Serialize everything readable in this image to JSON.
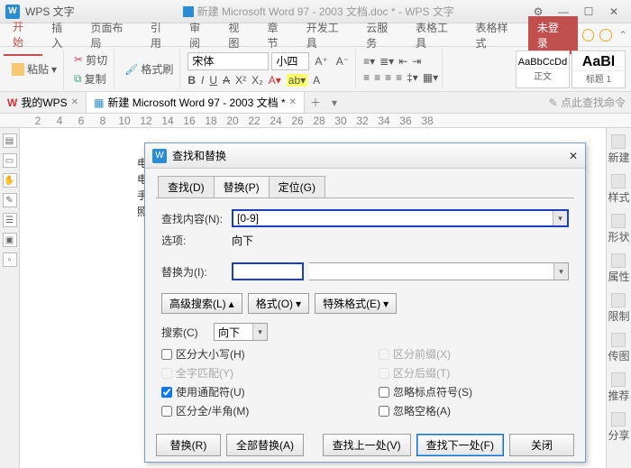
{
  "title_bar": {
    "app_name": "WPS 文字",
    "doc_name": "新建 Microsoft Word 97 - 2003 文档.doc * - WPS 文字"
  },
  "ribbon": {
    "tabs": [
      "开始",
      "插入",
      "页面布局",
      "引用",
      "审阅",
      "视图",
      "章节",
      "开发工具",
      "云服务",
      "表格工具",
      "表格样式"
    ],
    "login": "未登录"
  },
  "toolbar": {
    "cut": "剪切",
    "copy": "复制",
    "paste": "粘贴",
    "brush": "格式刷",
    "font_name": "宋体",
    "font_size": "小四",
    "style1_prev": "AaBbCcDd",
    "style1_lbl": "正文",
    "style2_prev": "AaBl",
    "style2_lbl": "标题 1"
  },
  "doc_tabs": {
    "home": "我的WPS",
    "doc": "新建 Microsoft Word 97 - 2003 文档 *",
    "cmd": "点此查找命令"
  },
  "doc_text": {
    "l1": "电行",
    "l2": "电讠",
    "l3": "手朾",
    "l4": "照丿"
  },
  "right_panel": [
    "新建",
    "样式",
    "形状",
    "属性",
    "限制",
    "传图",
    "推荐",
    "分享"
  ],
  "ruler": [
    "2",
    "4",
    "6",
    "8",
    "10",
    "12",
    "14",
    "16",
    "18",
    "20",
    "22",
    "24",
    "26",
    "28",
    "30",
    "32",
    "34",
    "36",
    "38"
  ],
  "dialog": {
    "title": "查找和替换",
    "tabs": {
      "find": "查找(D)",
      "replace": "替换(P)",
      "goto": "定位(G)"
    },
    "find_label": "查找内容(N):",
    "find_value": "[0-9]",
    "options_label": "选项:",
    "options_value": "向下",
    "replace_label": "替换为(I):",
    "replace_value": "",
    "adv": "高级搜索(L)",
    "format": "格式(O)",
    "special": "特殊格式(E)",
    "search_label": "搜索(C)",
    "search_value": "向下",
    "checks": {
      "case": "区分大小写(H)",
      "whole": "全字匹配(Y)",
      "wildcard": "使用通配符(U)",
      "width": "区分全/半角(M)",
      "prefix": "区分前缀(X)",
      "suffix": "区分后缀(T)",
      "punct": "忽略标点符号(S)",
      "space": "忽略空格(A)"
    },
    "footer": {
      "replace": "替换(R)",
      "replace_all": "全部替换(A)",
      "find_prev": "查找上一处(V)",
      "find_next": "查找下一处(F)",
      "close": "关闭"
    }
  }
}
